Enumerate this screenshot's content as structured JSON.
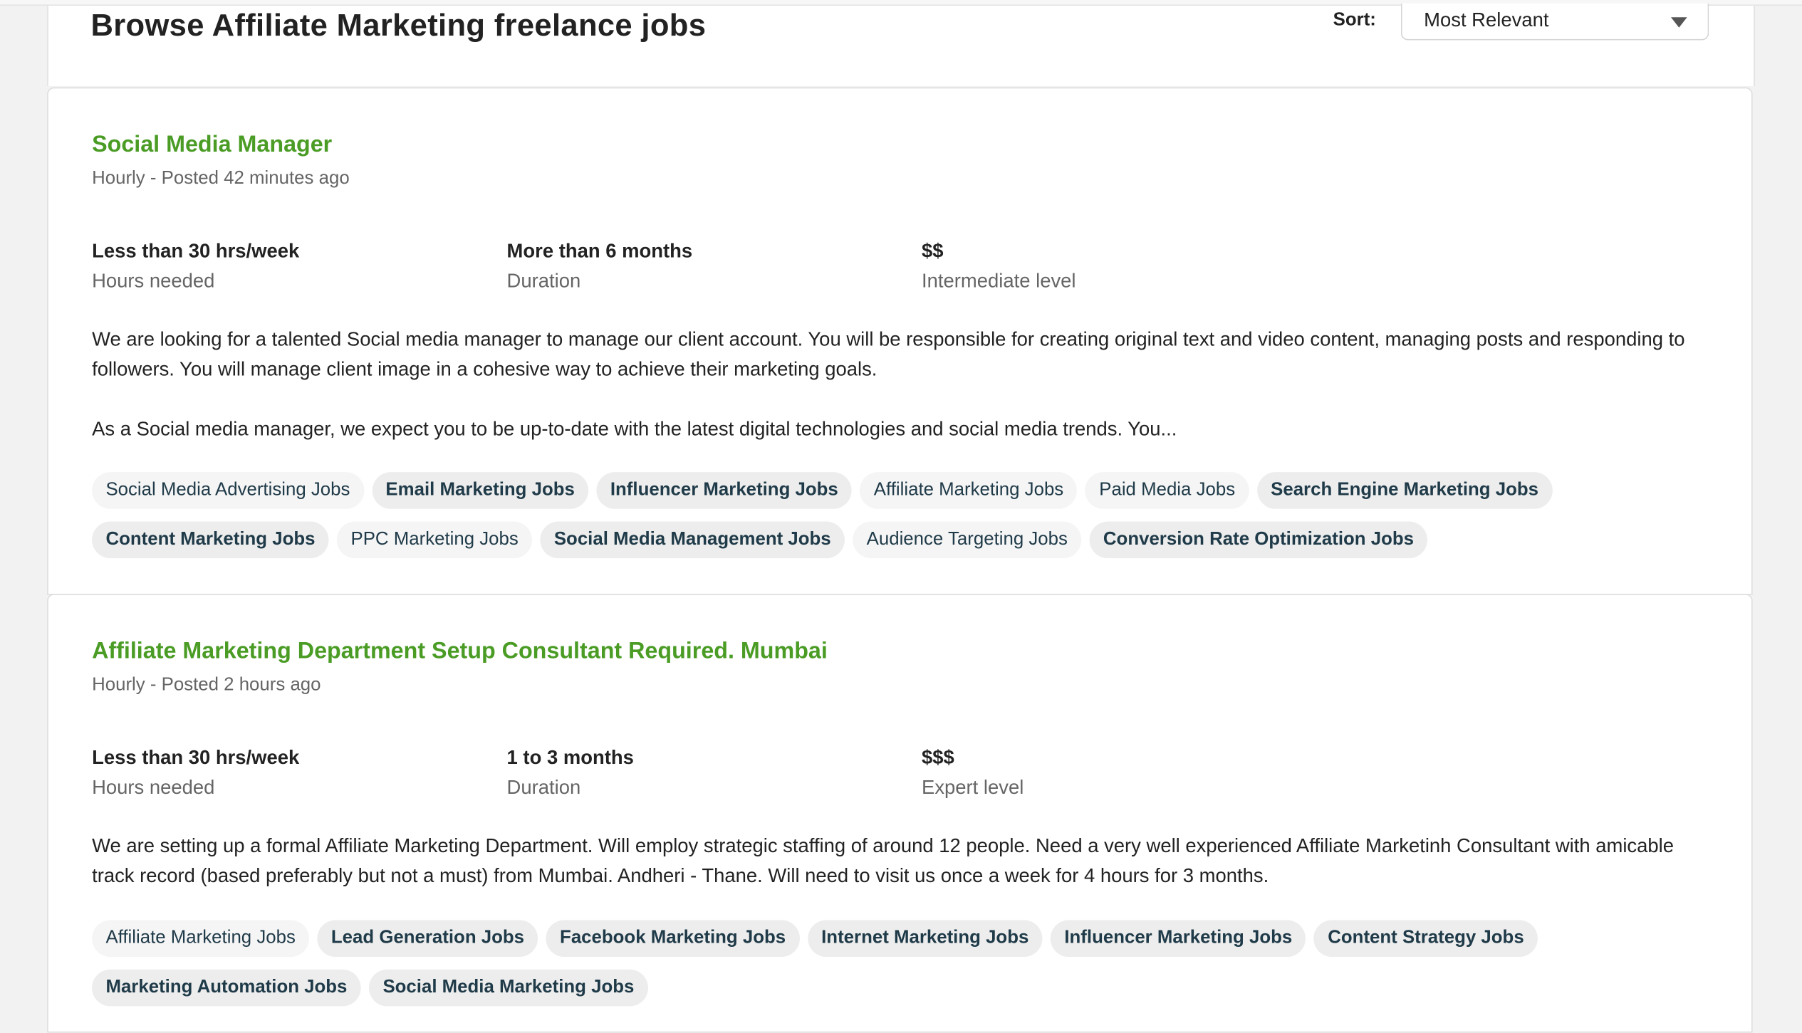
{
  "header": {
    "title": "Browse Affiliate Marketing freelance jobs",
    "sort_label": "Sort:",
    "sort_value": "Most Relevant"
  },
  "jobs": [
    {
      "title": "Social Media Manager",
      "meta": "Hourly - Posted 42 minutes ago",
      "stats": [
        {
          "value": "Less than 30 hrs/week",
          "label": "Hours needed"
        },
        {
          "value": "More than 6 months",
          "label": "Duration"
        },
        {
          "value": "$$",
          "label": "Intermediate level"
        }
      ],
      "description": [
        "We are looking for a talented Social media manager to manage our client account. You will be responsible for creating original text and video content, managing posts and responding to followers. You will manage client image in a cohesive way to achieve their marketing goals.",
        "As a Social media manager, we expect you to be up-to-date with the latest digital technologies and social media trends. You..."
      ],
      "tags": [
        {
          "label": "Social Media Advertising Jobs",
          "bold": false
        },
        {
          "label": "Email Marketing Jobs",
          "bold": true
        },
        {
          "label": "Influencer Marketing Jobs",
          "bold": true
        },
        {
          "label": "Affiliate Marketing Jobs",
          "bold": false
        },
        {
          "label": "Paid Media Jobs",
          "bold": false
        },
        {
          "label": "Search Engine Marketing Jobs",
          "bold": true
        },
        {
          "label": "Content Marketing Jobs",
          "bold": true
        },
        {
          "label": "PPC Marketing Jobs",
          "bold": false
        },
        {
          "label": "Social Media Management Jobs",
          "bold": true
        },
        {
          "label": "Audience Targeting Jobs",
          "bold": false
        },
        {
          "label": "Conversion Rate Optimization Jobs",
          "bold": true
        }
      ]
    },
    {
      "title": "Affiliate Marketing Department Setup Consultant Required. Mumbai",
      "meta": "Hourly - Posted 2 hours ago",
      "stats": [
        {
          "value": "Less than 30 hrs/week",
          "label": "Hours needed"
        },
        {
          "value": "1 to 3 months",
          "label": "Duration"
        },
        {
          "value": "$$$",
          "label": "Expert level"
        }
      ],
      "description": [
        "We are setting up a formal Affiliate Marketing Department. Will employ strategic staffing of around 12 people. Need a very well experienced Affiliate Marketinh Consultant with amicable track record (based preferably but not a must) from Mumbai. Andheri - Thane. Will need to visit us once a week for 4 hours for 3 months."
      ],
      "tags": [
        {
          "label": "Affiliate Marketing Jobs",
          "bold": false
        },
        {
          "label": "Lead Generation Jobs",
          "bold": true
        },
        {
          "label": "Facebook Marketing Jobs",
          "bold": true
        },
        {
          "label": "Internet Marketing Jobs",
          "bold": true
        },
        {
          "label": "Influencer Marketing Jobs",
          "bold": true
        },
        {
          "label": "Content Strategy Jobs",
          "bold": true
        },
        {
          "label": "Marketing Automation Jobs",
          "bold": true
        },
        {
          "label": "Social Media Marketing Jobs",
          "bold": true
        }
      ]
    }
  ],
  "colors": {
    "job_title": "#4a9c25",
    "tag_text": "#1f3a48",
    "tag_bg": "#ededed"
  },
  "icons": {
    "sort_caret": "caret-down-icon"
  }
}
